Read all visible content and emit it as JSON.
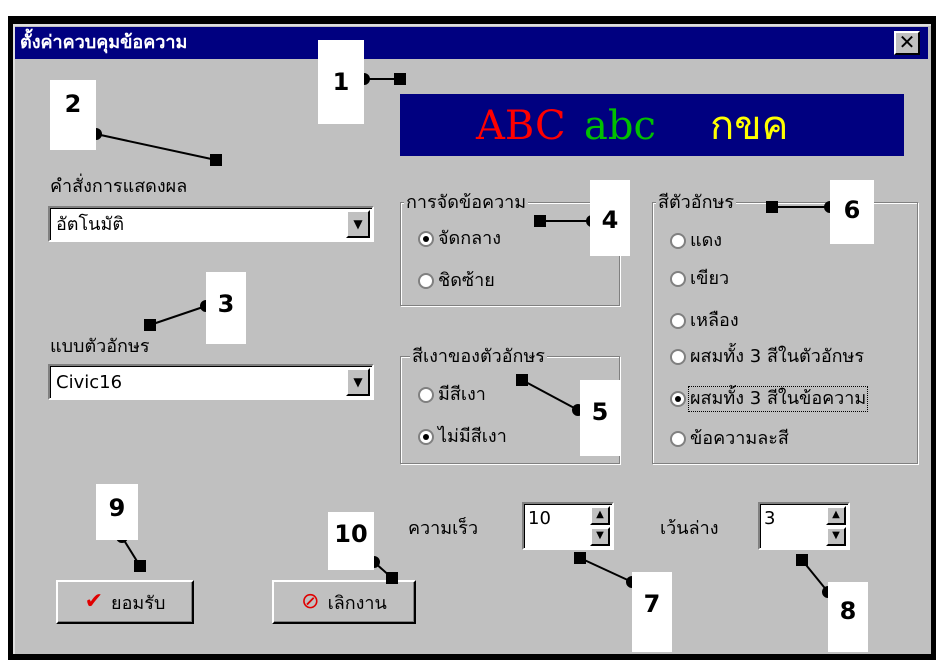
{
  "window": {
    "title": "ตั้งค่าควบคุมข้อความ",
    "close_symbol": "✕"
  },
  "preview": {
    "segments": [
      {
        "text": "ABC",
        "color": "#ff0000"
      },
      {
        "text": "abc",
        "color": "#00c000"
      },
      {
        "text": "กขค",
        "color": "#ffff00"
      }
    ],
    "background": "#000080"
  },
  "display_command": {
    "label": "คำสั่งการแสดงผล",
    "value": "อัตโนมัติ"
  },
  "font_style": {
    "label": "แบบตัวอักษร",
    "value": "Civic16"
  },
  "text_align": {
    "label": "การจัดข้อความ",
    "options": [
      {
        "label": "จัดกลาง",
        "selected": true
      },
      {
        "label": "ชิดซ้าย",
        "selected": false
      }
    ]
  },
  "text_shadow": {
    "label": "สีเงาของตัวอักษร",
    "options": [
      {
        "label": "มีสีเงา",
        "selected": false
      },
      {
        "label": "ไม่มีสีเงา",
        "selected": true
      }
    ]
  },
  "text_color": {
    "label": "สีตัวอักษร",
    "options": [
      {
        "label": "แดง",
        "selected": false
      },
      {
        "label": "เขียว",
        "selected": false
      },
      {
        "label": "เหลือง",
        "selected": false
      },
      {
        "label": "ผสมทั้ง 3 สีในตัวอักษร",
        "selected": false
      },
      {
        "label": "ผสมทั้ง 3 สีในข้อความ",
        "selected": true
      },
      {
        "label": "ข้อความละสี",
        "selected": false
      }
    ]
  },
  "speed": {
    "label": "ความเร็ว",
    "value": "10"
  },
  "bottom_gap": {
    "label": "เว้นล่าง",
    "value": "3"
  },
  "buttons": {
    "ok": {
      "label": "ยอมรับ",
      "icon": "checkmark-icon"
    },
    "cancel": {
      "label": "เลิกงาน",
      "icon": "cancel-icon"
    }
  },
  "callouts": [
    "1",
    "2",
    "3",
    "4",
    "5",
    "6",
    "7",
    "8",
    "9",
    "10"
  ]
}
